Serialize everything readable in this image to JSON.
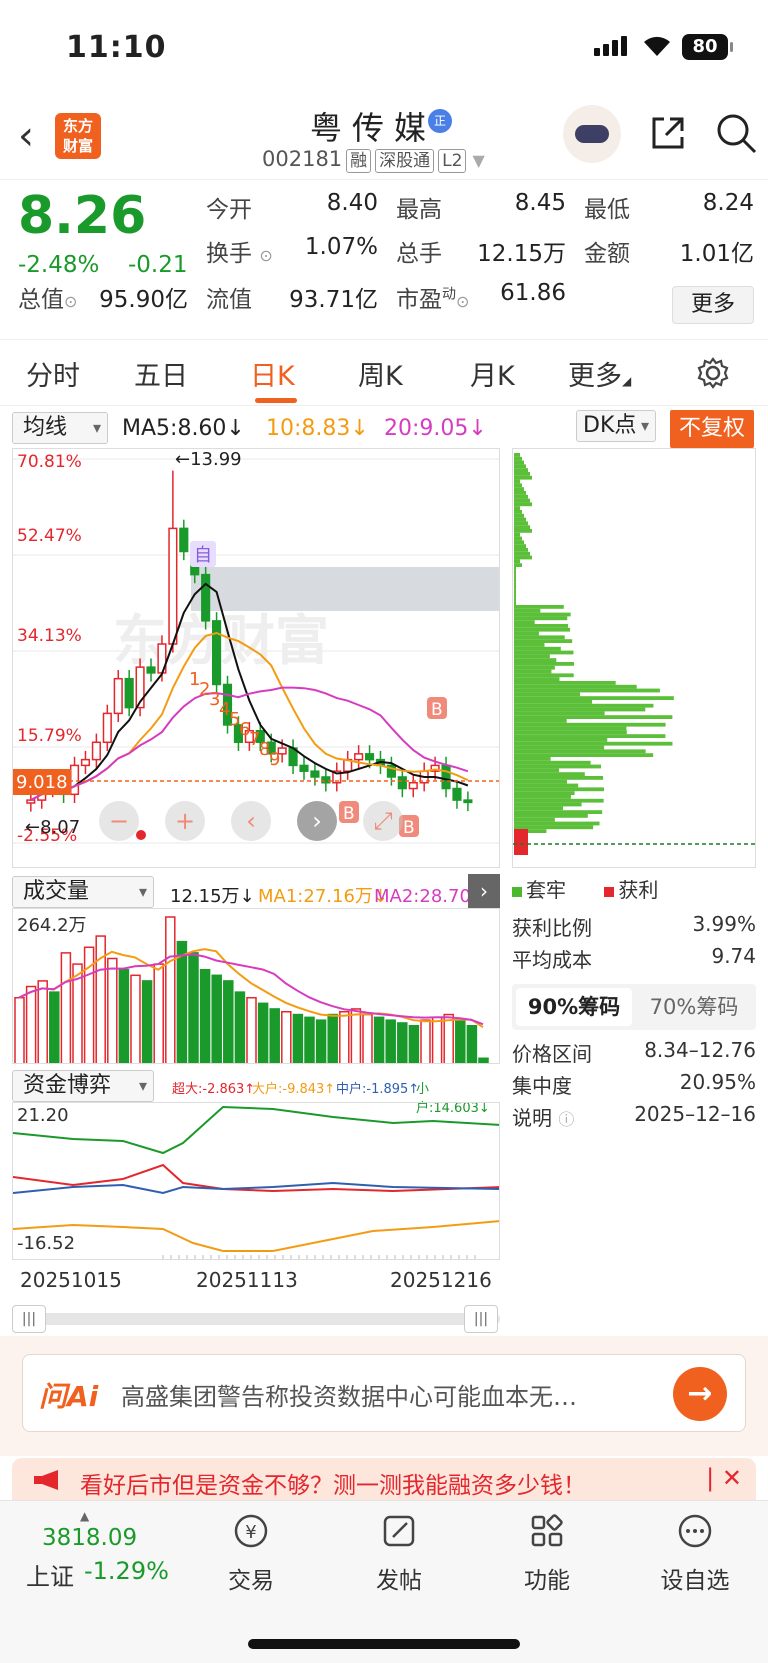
{
  "status": {
    "time": "11:10",
    "battery": "80"
  },
  "header": {
    "logo_line1": "东方",
    "logo_line2": "财富",
    "stock_name": "粤传媒",
    "zheng_badge": "正",
    "code": "002181",
    "tags": [
      "融",
      "深股通",
      "L2"
    ]
  },
  "quote": {
    "price": "8.26",
    "change_pct": "-2.48%",
    "change_amt": "-0.21",
    "fields": [
      {
        "label": "今开",
        "value": "8.40",
        "color": "green"
      },
      {
        "label": "最高",
        "value": "8.45",
        "color": "green"
      },
      {
        "label": "最低",
        "value": "8.24",
        "color": "green"
      },
      {
        "label": "换手",
        "value": "1.07%",
        "color": "normal"
      },
      {
        "label": "总手",
        "value": "12.15万",
        "color": "normal"
      },
      {
        "label": "金额",
        "value": "1.01亿",
        "color": "normal"
      },
      {
        "label": "总值",
        "value": "95.90亿",
        "color": "normal"
      },
      {
        "label": "流值",
        "value": "93.71亿",
        "color": "normal"
      },
      {
        "label": "市盈",
        "value": "61.86",
        "color": "normal"
      }
    ],
    "pe_sup": "动",
    "more": "更多"
  },
  "tabs": [
    "分时",
    "五日",
    "日K",
    "周K",
    "月K",
    "更多"
  ],
  "ma": {
    "selector": "均线",
    "ma5": "MA5:8.60↓",
    "ma10": "10:8.83↓",
    "ma20": "20:9.05↓",
    "dk": "DK点",
    "fq": "不复权"
  },
  "kline": {
    "y_labels": [
      "70.81%",
      "52.47%",
      "34.13%",
      "15.79%",
      "-2.55%"
    ],
    "price_tag": "9.018",
    "high_label": "←13.99",
    "low_label": "←8.07",
    "self_marker": "自",
    "b_marker": "B",
    "seq_nums": [
      "1",
      "2",
      "3",
      "4",
      "5",
      "6",
      "7",
      "8",
      "9"
    ],
    "controls": [
      "−",
      "+",
      "‹",
      "›",
      "⤢"
    ],
    "watermark": "东方财富"
  },
  "chip": {
    "legend_hold": "套牢",
    "legend_profit": "获利",
    "rows": [
      {
        "label": "获利比例",
        "value": "3.99%"
      },
      {
        "label": "平均成本",
        "value": "9.74"
      }
    ],
    "seg_on": "90%筹码",
    "seg_off": "70%筹码",
    "rows2": [
      {
        "label": "价格区间",
        "value": "8.34–12.76"
      },
      {
        "label": "集中度",
        "value": "20.95%"
      },
      {
        "label": "说明",
        "value": "2025–12–16"
      }
    ]
  },
  "volume": {
    "selector": "成交量",
    "vol": "12.15万↓",
    "ma1": "MA1:27.16万↓",
    "ma2": "MA2:28.70万",
    "max_label": "264.2万"
  },
  "capital": {
    "selector": "资金博弈",
    "super": "超大:-2.863↑",
    "large": "大户:-9.843↑",
    "mid": "中户:-1.895↑",
    "small": "小户:14.603↓",
    "top_label": "21.20",
    "bottom_label": "-16.52"
  },
  "dates": [
    "20251015",
    "20251113",
    "20251216"
  ],
  "ai": {
    "logo": "问Ai",
    "text": "高盛集团警告称投资数据中心可能血本无…"
  },
  "ad": {
    "text": "看好后市但是资金不够？测一测我能融资多少钱！"
  },
  "bottom": {
    "index_value": "3818.09",
    "index_name": "上证",
    "index_change": "-1.29%",
    "nav": [
      "交易",
      "发帖",
      "功能",
      "设自选"
    ]
  },
  "colors": {
    "up": "#e4262d",
    "down": "#1a9a2a",
    "accent": "#f0601e",
    "ma10": "#f39c12",
    "ma20": "#d63cc0"
  },
  "chart_data": {
    "type": "candlestick",
    "title": "",
    "candles_close": [
      8.3,
      8.5,
      8.6,
      8.4,
      8.9,
      9.0,
      9.3,
      9.8,
      10.4,
      9.9,
      10.6,
      10.5,
      11.0,
      13.0,
      12.6,
      12.2,
      11.4,
      10.3,
      9.6,
      9.3,
      9.5,
      9.3,
      9.1,
      9.2,
      8.9,
      8.8,
      8.7,
      8.6,
      8.8,
      9.0,
      9.1,
      9.0,
      8.9,
      8.7,
      8.5,
      8.6,
      8.8,
      8.9,
      8.5,
      8.3,
      8.26
    ],
    "volume": [
      120,
      140,
      150,
      130,
      200,
      180,
      210,
      230,
      190,
      170,
      160,
      150,
      180,
      264,
      220,
      200,
      170,
      160,
      150,
      130,
      120,
      110,
      100,
      95,
      90,
      85,
      80,
      90,
      95,
      100,
      90,
      85,
      80,
      75,
      70,
      80,
      85,
      90,
      80,
      70,
      12
    ]
  }
}
